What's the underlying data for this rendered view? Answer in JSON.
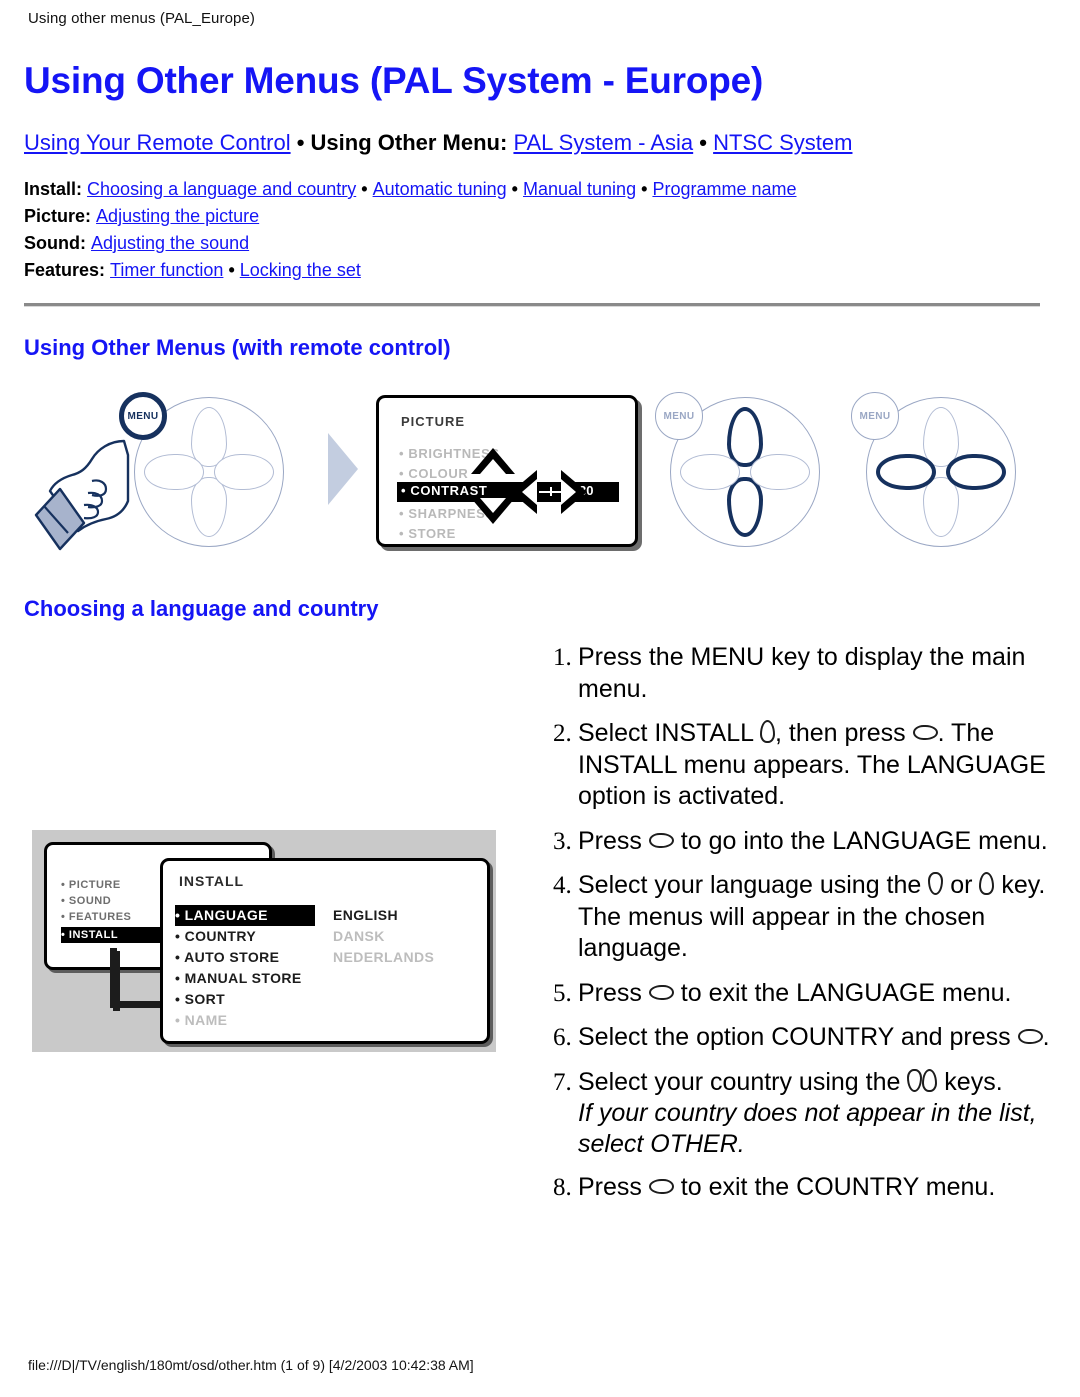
{
  "print_header": "Using other menus (PAL_Europe)",
  "page_title": "Using Other Menus (PAL System - Europe)",
  "colors": {
    "link": "#1515f5",
    "heading": "#1515f5",
    "text": "#000000",
    "rule": "#8a8a8a",
    "figure_background": "#c9c9c9",
    "remote_outline": "#9aa7c4",
    "remote_active": "#16315e",
    "arrow": "#c3cde0"
  },
  "nav_primary": {
    "link1": "Using Your Remote Control",
    "separator1": " • ",
    "label": "Using Other Menu:",
    "link2": "PAL System - Asia",
    "separator2": " • ",
    "link3": "NTSC System"
  },
  "nav_secondary": [
    {
      "label": "Install:",
      "links": [
        "Choosing a language and country",
        "Automatic tuning",
        "Manual tuning",
        "Programme name"
      ]
    },
    {
      "label": "Picture:",
      "links": [
        "Adjusting the picture"
      ]
    },
    {
      "label": "Sound:",
      "links": [
        "Adjusting the sound"
      ]
    },
    {
      "label": "Features:",
      "links": [
        "Timer function",
        "Locking the set"
      ]
    }
  ],
  "section_title": "Using Other Menus (with remote control)",
  "subsection_title": "Choosing a language and country",
  "figure_remote": {
    "menu_label": "MENU"
  },
  "osd_picture": {
    "title": "PICTURE",
    "items": [
      "BRIGHTNESS",
      "COLOUR",
      "CONTRAST",
      "SHARPNESS",
      "STORE"
    ],
    "highlighted": "CONTRAST",
    "value": "30"
  },
  "osd_main_menu": {
    "items": [
      "PICTURE",
      "SOUND",
      "FEATURES",
      "INSTALL"
    ],
    "highlighted": "INSTALL"
  },
  "osd_install": {
    "title": "INSTALL",
    "items": [
      "LANGUAGE",
      "COUNTRY",
      "AUTO STORE",
      "MANUAL STORE",
      "SORT",
      "NAME"
    ],
    "highlighted": "LANGUAGE",
    "disabled": "NAME",
    "values": [
      "ENGLISH",
      "DANSK",
      "NEDERLANDS"
    ]
  },
  "steps": [
    {
      "parts": [
        {
          "t": "text",
          "v": "Press the MENU key to display the main menu."
        }
      ]
    },
    {
      "parts": [
        {
          "t": "text",
          "v": "Select INSTALL "
        },
        {
          "t": "key",
          "v": "key-up"
        },
        {
          "t": "text",
          "v": ", then press "
        },
        {
          "t": "key",
          "v": "key-right"
        },
        {
          "t": "text",
          "v": ". The INSTALL menu appears. The LANGUAGE option is activated."
        }
      ]
    },
    {
      "parts": [
        {
          "t": "text",
          "v": "Press "
        },
        {
          "t": "key",
          "v": "key-right"
        },
        {
          "t": "text",
          "v": " to go into the LANGUAGE menu."
        }
      ]
    },
    {
      "parts": [
        {
          "t": "text",
          "v": "Select your language using the "
        },
        {
          "t": "key",
          "v": "key-down"
        },
        {
          "t": "text",
          "v": " or "
        },
        {
          "t": "key",
          "v": "key-up"
        },
        {
          "t": "text",
          "v": " key."
        },
        {
          "t": "break"
        },
        {
          "t": "text",
          "v": "The menus will appear in the chosen language."
        }
      ]
    },
    {
      "parts": [
        {
          "t": "text",
          "v": "Press "
        },
        {
          "t": "key",
          "v": "key-left"
        },
        {
          "t": "text",
          "v": " to exit the LANGUAGE menu."
        }
      ]
    },
    {
      "parts": [
        {
          "t": "text",
          "v": "Select the option COUNTRY and press "
        },
        {
          "t": "key",
          "v": "key-right"
        },
        {
          "t": "text",
          "v": "."
        }
      ]
    },
    {
      "parts": [
        {
          "t": "text",
          "v": "Select your country using the "
        },
        {
          "t": "key",
          "v": "key-down"
        },
        {
          "t": "key",
          "v": "key-up"
        },
        {
          "t": "text",
          "v": " keys."
        },
        {
          "t": "note",
          "v": "If your country does not appear in the list, select OTHER."
        }
      ]
    },
    {
      "parts": [
        {
          "t": "text",
          "v": "Press "
        },
        {
          "t": "key",
          "v": "key-left"
        },
        {
          "t": "text",
          "v": " to exit the COUNTRY menu."
        }
      ]
    }
  ],
  "footer": "file:///D|/TV/english/180mt/osd/other.htm (1 of 9) [4/2/2003 10:42:38 AM]"
}
